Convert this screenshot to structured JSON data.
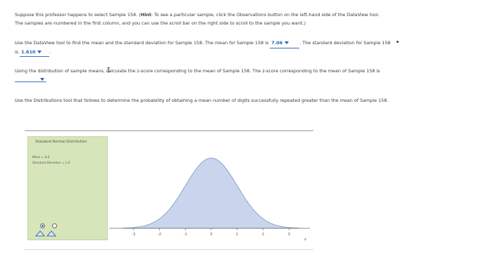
{
  "question": {
    "p1_a": "Suppose this professor happens to select Sample 158. (",
    "p1_hint": "Hint",
    "p1_b": ": To see a particular sample, click the Observations button on the left-hand side of the DataView tool. The samples are numbered in the first column, and you can use the scroll bar on the right side to scroll to the sample you want.)",
    "p2_a": "Use the DataView tool to find the mean and the standard deviation for Sample 158. The mean for Sample 158 is",
    "mean_value": "7.06",
    "p2_b": ". The standard deviation for Sample 158 is",
    "sd_value": "1.610",
    "p2_c": ".",
    "p3_a": "Using the distribution of sample means, calculate the z-score corresponding to the mean of Sample 158. The z-score corresponding to the mean of Sample 158 is",
    "p3_b": ".",
    "p4": "Use the Distributions tool that follows to determine the probability of obtaining a mean number of digits successfully repeated greater than the mean of Sample 158."
  },
  "tool": {
    "title": "Standard Normal Distribution",
    "mean_label": "Mean = 0.0",
    "sd_label": "Standard Deviation = 1.0",
    "x_ticks": [
      "-3",
      "-2",
      "-1",
      "0",
      "1",
      "2",
      "3"
    ],
    "x_axis_label": "z",
    "curve_fill": "#c9d5ec",
    "curve_stroke": "#7f93c2",
    "panel_color": "#d7e5ba"
  }
}
